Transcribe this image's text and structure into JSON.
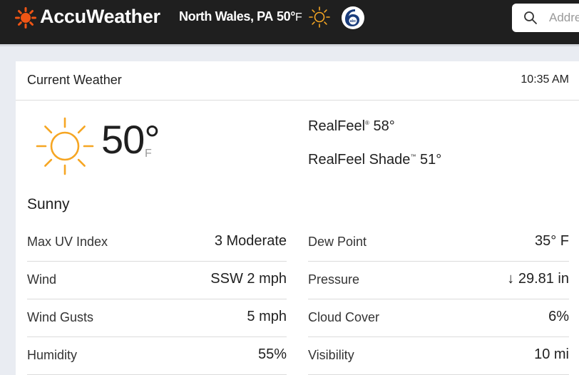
{
  "header": {
    "brand": "AccuWeather",
    "location": "North Wales, PA",
    "temp": "50°",
    "temp_unit": "F",
    "weather_icon": "sun-icon",
    "partner_logo": "6abc",
    "search": {
      "placeholder": "Address",
      "icon": "search-icon"
    },
    "colors": {
      "bar": "#1f1f1f",
      "accent": "#f05514",
      "sun": "#f6a623"
    }
  },
  "current_weather": {
    "title": "Current Weather",
    "time": "10:35 AM",
    "icon": "sun-icon",
    "temperature": "50°",
    "unit": "F",
    "realfeel_label": "RealFeel",
    "realfeel_mark": "®",
    "realfeel_value": "58°",
    "realfeel_shade_label": "RealFeel Shade",
    "realfeel_shade_mark": "™",
    "realfeel_shade_value": "51°",
    "phrase": "Sunny",
    "details_left": [
      {
        "label": "Max UV Index",
        "value": "3 Moderate"
      },
      {
        "label": "Wind",
        "value": "SSW 2 mph"
      },
      {
        "label": "Wind Gusts",
        "value": "5 mph"
      },
      {
        "label": "Humidity",
        "value": "55%"
      }
    ],
    "details_right": [
      {
        "label": "Dew Point",
        "value": "35° F"
      },
      {
        "label": "Pressure",
        "value": "↓ 29.81 in"
      },
      {
        "label": "Cloud Cover",
        "value": "6%"
      },
      {
        "label": "Visibility",
        "value": "10 mi"
      }
    ]
  }
}
